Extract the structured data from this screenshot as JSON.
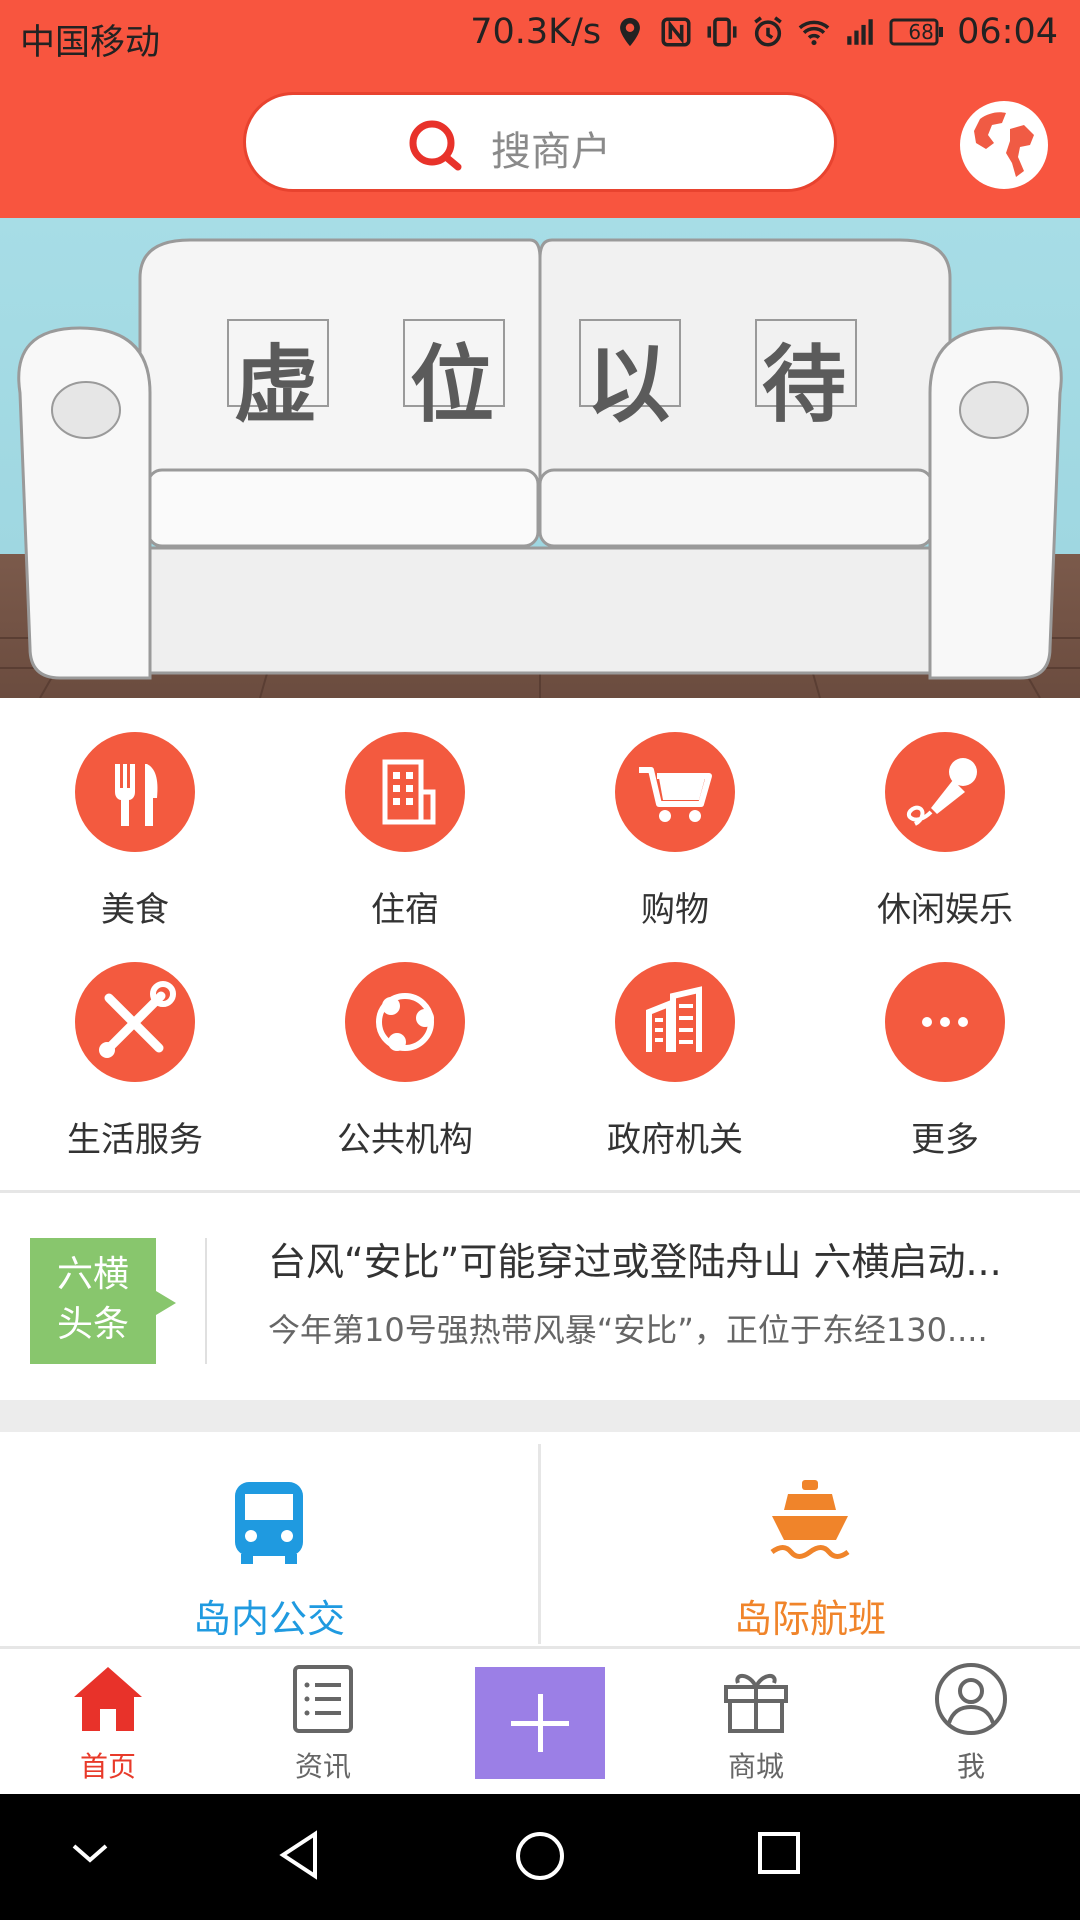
{
  "status_bar": {
    "carrier": "中国移动",
    "speed": "70.3K/s",
    "battery": "68",
    "time": "06:04"
  },
  "search": {
    "placeholder": "搜商户"
  },
  "banner": {
    "chars": [
      "虚",
      "位",
      "以",
      "待"
    ]
  },
  "categories": [
    {
      "label": "美食",
      "icon": "utensils-icon"
    },
    {
      "label": "住宿",
      "icon": "building-icon"
    },
    {
      "label": "购物",
      "icon": "cart-icon"
    },
    {
      "label": "休闲娱乐",
      "icon": "microphone-icon"
    },
    {
      "label": "生活服务",
      "icon": "tools-icon"
    },
    {
      "label": "公共机构",
      "icon": "network-icon"
    },
    {
      "label": "政府机关",
      "icon": "office-buildings-icon"
    },
    {
      "label": "更多",
      "icon": "more-icon"
    }
  ],
  "news": {
    "tag_line1": "六横",
    "tag_line2": "头条",
    "title": "台风“安比”可能穿过或登陆舟山 六横启动...",
    "summary": "今年第10号强热带风暴“安比”，正位于东经130...."
  },
  "transport": {
    "bus": {
      "label": "岛内公交",
      "color": "#1f9ae0"
    },
    "ferry": {
      "label": "岛际航班",
      "color": "#f0842a"
    }
  },
  "bottom_nav": [
    {
      "label": "首页",
      "active": true
    },
    {
      "label": "资讯",
      "active": false
    },
    {
      "label": "商城",
      "active": false
    },
    {
      "label": "我",
      "active": false
    }
  ],
  "colors": {
    "brand": "#f8553f",
    "plus": "#9b7fe6",
    "tag": "#88c66d"
  }
}
